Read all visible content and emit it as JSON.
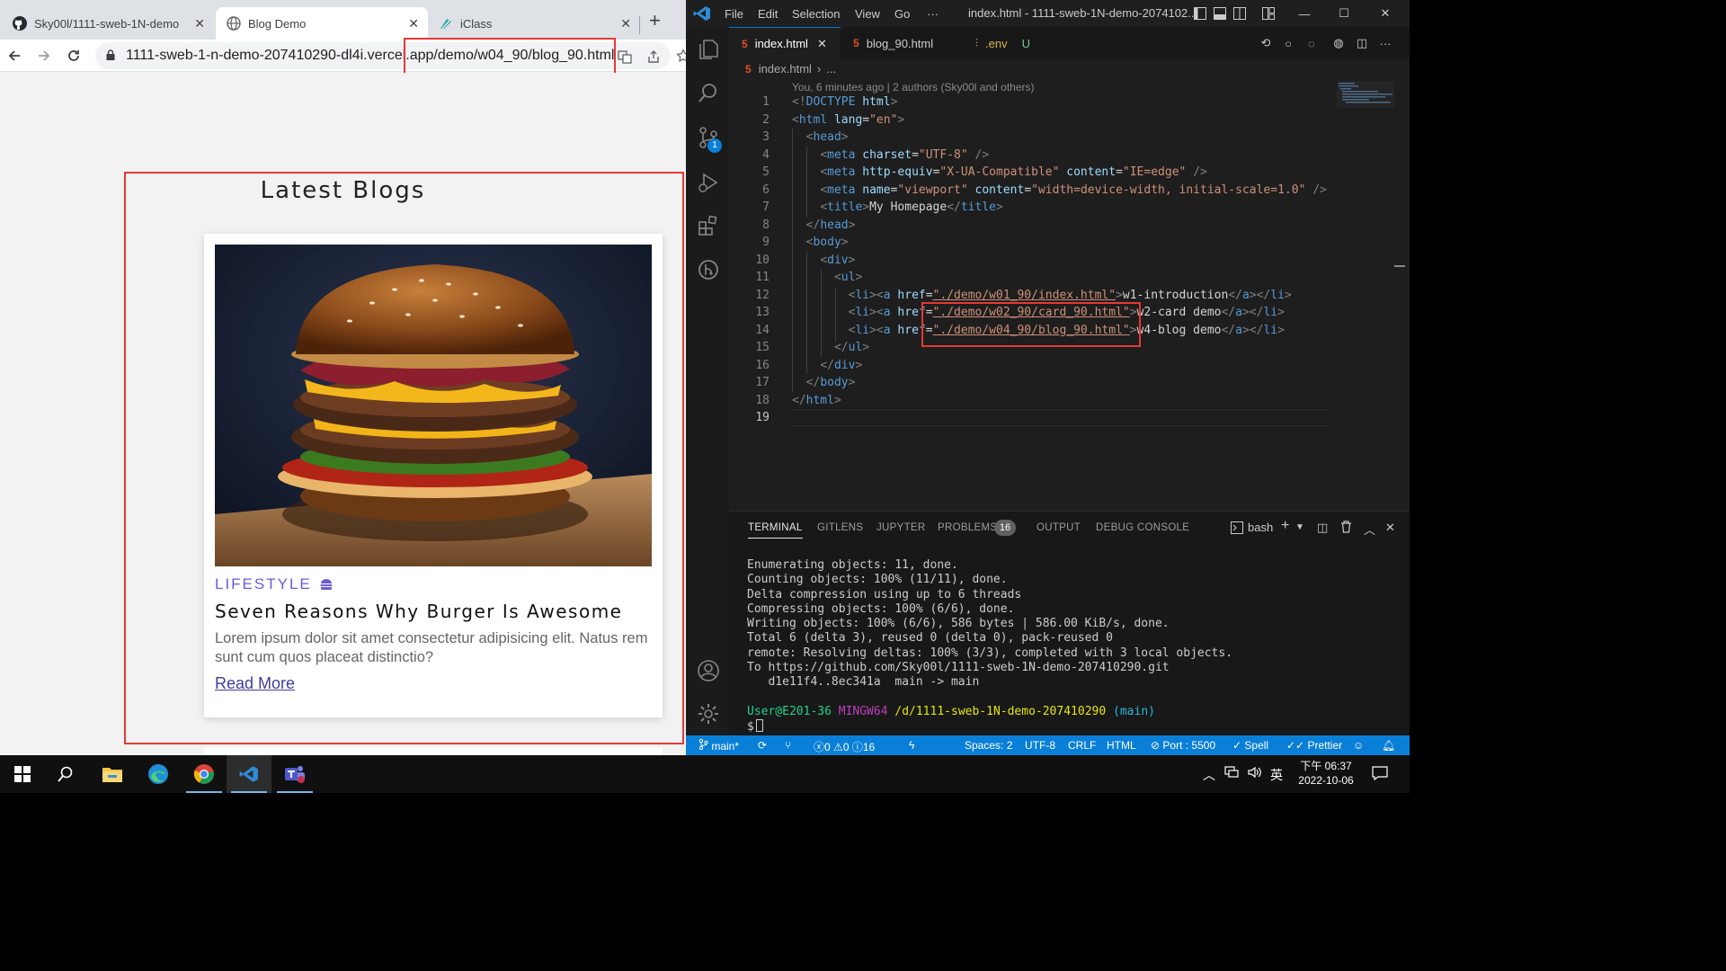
{
  "browser": {
    "tabs": [
      {
        "title": "Sky00l/1111-sweb-1N-demo",
        "icon": "github-icon",
        "active": false
      },
      {
        "title": "Blog Demo",
        "icon": "globe-icon",
        "active": true
      },
      {
        "title": "iClass",
        "icon": "iclass-icon",
        "active": false
      }
    ],
    "new_tab_label": "+",
    "url": "1111-sweb-1-n-demo-207410290-dl4i.vercel.app/demo/w04_90/blog_90.html",
    "page": {
      "heading": "Latest Blogs",
      "card": {
        "category": "LIFESTYLE",
        "title": "Seven Reasons Why Burger Is Awesome",
        "text": "Lorem ipsum dolor sit amet consectetur adipisicing elit. Natus rem sunt cum quos placeat distinctio?",
        "link": "Read More"
      }
    }
  },
  "vscode": {
    "menu": [
      "File",
      "Edit",
      "Selection",
      "View",
      "Go",
      "···"
    ],
    "window_title": "index.html - 1111-sweb-1N-demo-2074102...",
    "tabs": [
      {
        "label": "index.html",
        "active": true,
        "icon": "html-file-icon",
        "close": "✕"
      },
      {
        "label": "blog_90.html",
        "active": false,
        "icon": "html-file-icon"
      },
      {
        "label": ".env",
        "active": false,
        "icon": "env-file-icon",
        "status": "U"
      }
    ],
    "breadcrumb": [
      "index.html",
      "..."
    ],
    "blame": "You, 6 minutes ago | 2 authors (Sky00l and others)",
    "scm_badge": "1",
    "code_lines": [
      {
        "n": "1",
        "text": "<!DOCTYPE html>"
      },
      {
        "n": "2",
        "text": "<html lang=\"en\">"
      },
      {
        "n": "3",
        "text": "  <head>"
      },
      {
        "n": "4",
        "text": "    <meta charset=\"UTF-8\" />"
      },
      {
        "n": "5",
        "text": "    <meta http-equiv=\"X-UA-Compatible\" content=\"IE=edge\" />"
      },
      {
        "n": "6",
        "text": "    <meta name=\"viewport\" content=\"width=device-width, initial-scale=1.0\" />"
      },
      {
        "n": "7",
        "text": "    <title>My Homepage</title>"
      },
      {
        "n": "8",
        "text": "  </head>"
      },
      {
        "n": "9",
        "text": "  <body>"
      },
      {
        "n": "10",
        "text": "    <div>"
      },
      {
        "n": "11",
        "text": "      <ul>"
      },
      {
        "n": "12",
        "text": "        <li><a href=\"./demo/w01_90/index.html\">w1-introduction</a></li>"
      },
      {
        "n": "13",
        "text": "        <li><a href=\"./demo/w02_90/card_90.html\">w2-card demo</a></li>"
      },
      {
        "n": "14",
        "text": "        <li><a href=\"./demo/w04_90/blog_90.html\">w4-blog demo</a></li>"
      },
      {
        "n": "15",
        "text": "      </ul>"
      },
      {
        "n": "16",
        "text": "    </div>"
      },
      {
        "n": "17",
        "text": "  </body>"
      },
      {
        "n": "18",
        "text": "</html>"
      },
      {
        "n": "19",
        "text": ""
      }
    ],
    "panel": {
      "tabs": [
        "TERMINAL",
        "GITLENS",
        "JUPYTER",
        "PROBLEMS",
        "OUTPUT",
        "DEBUG CONSOLE"
      ],
      "problems_count": "16",
      "shell": "bash",
      "terminal_lines": [
        "Enumerating objects: 11, done.",
        "Counting objects: 100% (11/11), done.",
        "Delta compression using up to 6 threads",
        "Compressing objects: 100% (6/6), done.",
        "Writing objects: 100% (6/6), 586 bytes | 586.00 KiB/s, done.",
        "Total 6 (delta 3), reused 0 (delta 0), pack-reused 0",
        "remote: Resolving deltas: 100% (3/3), completed with 3 local objects.",
        "To https://github.com/Sky00l/1111-sweb-1N-demo-207410290.git",
        "   d1e11f4..8ec341a  main -> main"
      ],
      "prompt": {
        "user": "User@E201-36",
        "system": "MINGW64",
        "path": "/d/1111-sweb-1N-demo-207410290",
        "branch": "(main)",
        "symbol": "$"
      }
    },
    "statusbar": {
      "branch": "main*",
      "errors": "0",
      "warnings": "0",
      "infos": "16",
      "spaces": "Spaces: 2",
      "encoding": "UTF-8",
      "eol": "CRLF",
      "language": "HTML",
      "port": "Port : 5500",
      "spell": "Spell",
      "prettier": "Prettier"
    }
  },
  "taskbar": {
    "apps": [
      "start-icon",
      "search-icon",
      "file-explorer-icon",
      "edge-icon",
      "chrome-icon",
      "vscode-icon",
      "teams-icon"
    ],
    "ime": "英",
    "time": "下午 06:37",
    "date": "2022-10-06"
  },
  "colors": {
    "highlight": "#e53935",
    "statusbar": "#0a7fd8",
    "category": "#6b5bd6"
  }
}
